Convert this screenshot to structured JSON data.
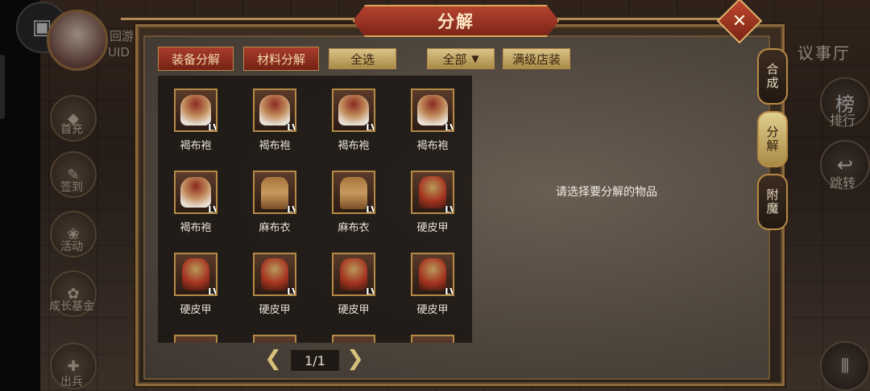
{
  "hud": {
    "server_text": "回游",
    "uid_label": "UID"
  },
  "left_menu": [
    {
      "label": "首充",
      "icon": "first-recharge-icon"
    },
    {
      "label": "签到",
      "icon": "sign-in-icon"
    },
    {
      "label": "活动",
      "icon": "activity-icon"
    },
    {
      "label": "成长基金",
      "icon": "growth-fund-icon"
    },
    {
      "label": "出兵",
      "icon": "dispatch-troops-icon"
    }
  ],
  "right_hud": {
    "hall": "议事厅",
    "rank": "排行",
    "jump": "跳转"
  },
  "panel": {
    "title": "分解",
    "close": "✕",
    "buttons": {
      "equip_decompose": "装备分解",
      "material_decompose": "材料分解",
      "select_all": "全选",
      "filter": "全部",
      "max_level_store": "满级店装"
    },
    "hint": "请选择要分解的物品",
    "page": "1/1",
    "side_tabs": [
      "合成",
      "分解",
      "附魔"
    ]
  },
  "items": [
    {
      "name": "褐布袍",
      "level": "LV:5",
      "kind": "robe"
    },
    {
      "name": "褐布袍",
      "level": "LV:5",
      "kind": "robe"
    },
    {
      "name": "褐布袍",
      "level": "LV:5",
      "kind": "robe"
    },
    {
      "name": "褐布袍",
      "level": "LV:5",
      "kind": "robe"
    },
    {
      "name": "褐布袍",
      "level": "LV:5",
      "kind": "robe"
    },
    {
      "name": "麻布衣",
      "level": "LV:5",
      "kind": "cloth"
    },
    {
      "name": "麻布衣",
      "level": "LV:5",
      "kind": "cloth"
    },
    {
      "name": "硬皮甲",
      "level": "LV:5",
      "kind": "armor"
    },
    {
      "name": "硬皮甲",
      "level": "LV:5",
      "kind": "armor"
    },
    {
      "name": "硬皮甲",
      "level": "LV:5",
      "kind": "armor"
    },
    {
      "name": "硬皮甲",
      "level": "LV:5",
      "kind": "armor"
    },
    {
      "name": "硬皮甲",
      "level": "LV:5",
      "kind": "armor"
    }
  ]
}
